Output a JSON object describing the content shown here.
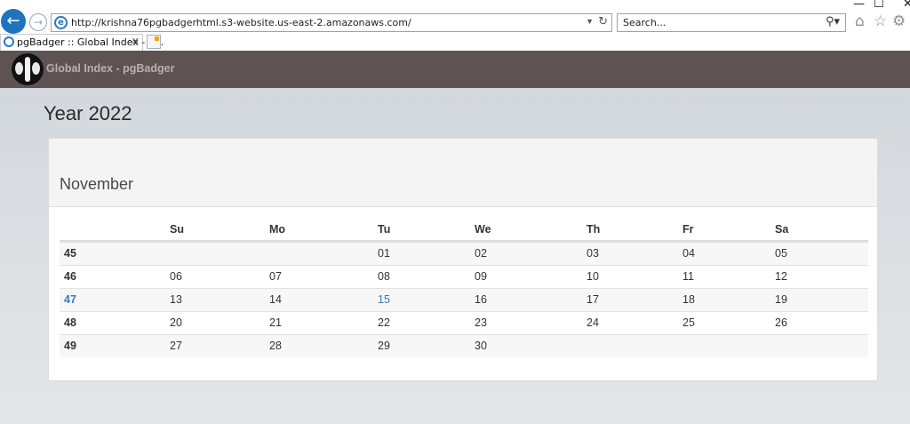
{
  "browser": {
    "window_controls": [
      "—",
      "☐",
      "✕"
    ],
    "url": "http://krishna76pgbadgerhtml.s3-website.us-east-2.amazonaws.com/",
    "search_placeholder": "Search...",
    "tab_title": "pgBadger :: Global Index - p...",
    "icons": [
      "back-icon",
      "forward-icon",
      "ie-icon",
      "refresh-icon",
      "search-icon",
      "home-icon",
      "favorites-star-icon",
      "settings-gear-icon",
      "tab-close-icon",
      "new-tab-icon"
    ]
  },
  "app": {
    "title": "Global Index - pgBadger",
    "header_color": "#5d5353"
  },
  "page": {
    "year": "Year 2022",
    "month": "November"
  },
  "calendar": {
    "headers": [
      "",
      "Su",
      "Mo",
      "Tu",
      "We",
      "Th",
      "Fr",
      "Sa"
    ],
    "weeks": [
      {
        "week": "45",
        "days": [
          "",
          "",
          "01",
          "02",
          "03",
          "04",
          "05"
        ],
        "link": false
      },
      {
        "week": "46",
        "days": [
          "06",
          "07",
          "08",
          "09",
          "10",
          "11",
          "12"
        ],
        "link": false
      },
      {
        "week": "47",
        "days": [
          "13",
          "14",
          "15",
          "16",
          "17",
          "18",
          "19"
        ],
        "link": true,
        "link_day_index": 2
      },
      {
        "week": "48",
        "days": [
          "20",
          "21",
          "22",
          "23",
          "24",
          "25",
          "26"
        ],
        "link": false
      },
      {
        "week": "49",
        "days": [
          "27",
          "28",
          "29",
          "30",
          "",
          "",
          ""
        ],
        "link": false
      }
    ],
    "link_color": "#3a79b8"
  }
}
